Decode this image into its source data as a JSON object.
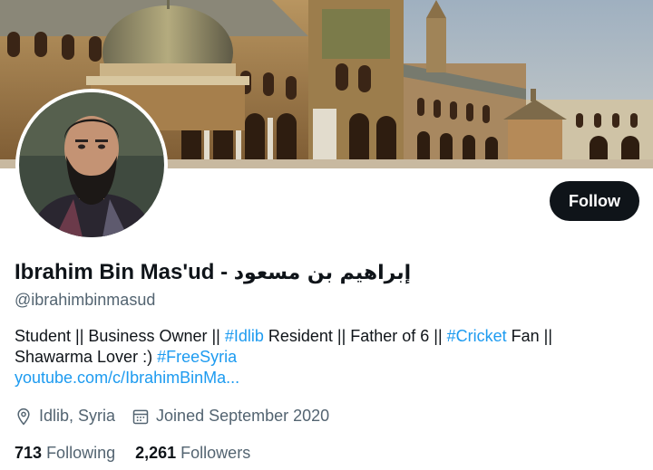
{
  "profile": {
    "display_name": "Ibrahim Bin Mas'ud - ",
    "display_name_arabic": "إبراهيم بن مسعود",
    "handle": "@ibrahimbinmasud",
    "follow_label": "Follow"
  },
  "bio": {
    "line1_a": "Student || Business Owner || ",
    "tag_idlib": "#Idlib",
    "line1_b": " Resident || Father of 6 || ",
    "tag_cricket": "#Cricket",
    "line1_c": " Fan ||",
    "line2_a": "Shawarma Lover :) ",
    "tag_freesyria": "#FreeSyria",
    "link": "youtube.com/c/IbrahimBinMa..."
  },
  "meta": {
    "location": "Idlib, Syria",
    "joined": "Joined September 2020",
    "location_icon": "location-pin-icon",
    "calendar_icon": "calendar-icon"
  },
  "stats": {
    "following_count": "713",
    "following_label": "Following",
    "followers_count": "2,261",
    "followers_label": "Followers"
  },
  "colors": {
    "accent": "#1d9bf0",
    "text": "#0f1419",
    "secondary": "#536471",
    "button": "#0f1419"
  }
}
